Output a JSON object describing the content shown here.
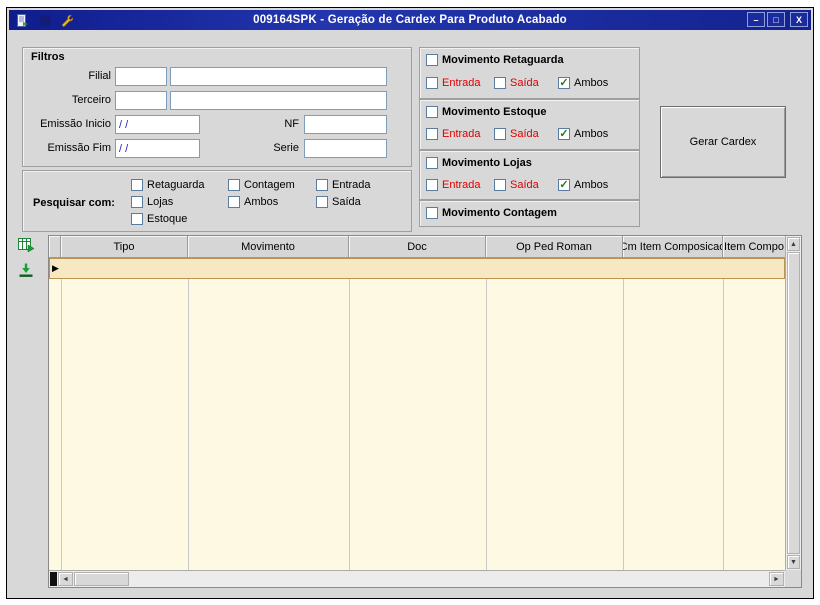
{
  "window": {
    "title": "009164SPK - Geração de Cardex Para Produto Acabado",
    "controls": {
      "minimize": "–",
      "maximize": "□",
      "close": "X"
    }
  },
  "colors": {
    "titlebar_blue": "#1b2a9e",
    "alert_red": "#dd0000",
    "grid_body_cream": "#fdf9e2",
    "selected_row_tan": "#f6e9c2",
    "check_green": "#1e7a1e"
  },
  "icons": {
    "row_marker": "▶",
    "scroll_up": "▲",
    "scroll_down": "▼",
    "scroll_left": "◄",
    "scroll_right": "►"
  },
  "filtros": {
    "title": "Filtros",
    "filial_label": "Filial",
    "terceiro_label": "Terceiro",
    "emissao_inicio_label": "Emissão Inicio",
    "emissao_fim_label": "Emissão Fim",
    "nf_label": "NF",
    "serie_label": "Serie",
    "filial_code": "",
    "filial_name": "",
    "terceiro_code": "",
    "terceiro_name": "",
    "emissao_inicio_value": "/ /",
    "emissao_fim_value": "/ /",
    "nf_value": "",
    "serie_value": ""
  },
  "pesquisar": {
    "title": "Pesquisar com:",
    "options": [
      {
        "label": "Retaguarda",
        "check": ""
      },
      {
        "label": "Contagem",
        "check": ""
      },
      {
        "label": "Entrada",
        "check": ""
      },
      {
        "label": "Lojas",
        "check": ""
      },
      {
        "label": "Ambos",
        "check": ""
      },
      {
        "label": "Saída",
        "check": ""
      },
      {
        "label": "Estoque",
        "check": ""
      }
    ]
  },
  "movimentos": [
    {
      "title": "Movimento Retaguarda",
      "check": "",
      "options": [
        {
          "label": "Entrada",
          "check": ""
        },
        {
          "label": "Saída",
          "check": ""
        },
        {
          "label": "Ambos",
          "check": "✓"
        }
      ]
    },
    {
      "title": "Movimento Estoque",
      "check": "",
      "options": [
        {
          "label": "Entrada",
          "check": ""
        },
        {
          "label": "Saída",
          "check": ""
        },
        {
          "label": "Ambos",
          "check": "✓"
        }
      ]
    },
    {
      "title": "Movimento Lojas",
      "check": "",
      "options": [
        {
          "label": "Entrada",
          "check": ""
        },
        {
          "label": "Saída",
          "check": ""
        },
        {
          "label": "Ambos",
          "check": "✓"
        }
      ]
    },
    {
      "title": "Movimento Contagem",
      "check": "",
      "options": []
    }
  ],
  "actions": {
    "gerar_cardex_label": "Gerar Cardex"
  },
  "grid": {
    "columns": [
      "Tipo",
      "Movimento",
      "Doc",
      "Op Ped Roman",
      "Cm Item Composicao",
      "Item Compo"
    ],
    "rows": [
      {
        "selected": true,
        "cells": [
          "",
          "",
          "",
          "",
          "",
          ""
        ]
      }
    ]
  }
}
